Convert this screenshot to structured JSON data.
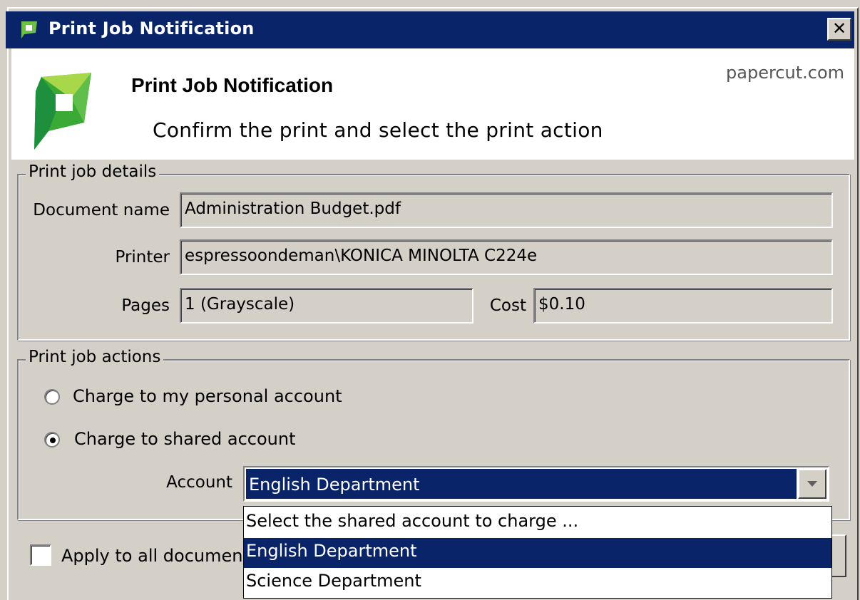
{
  "window": {
    "title": "Print Job Notification",
    "close_label": "✕"
  },
  "header": {
    "title": "Print Job Notification",
    "subtitle": "Confirm the print and select the print action",
    "brand": "papercut.com"
  },
  "details": {
    "legend": "Print job details",
    "document_label": "Document name",
    "document_value": "Administration Budget.pdf",
    "printer_label": "Printer",
    "printer_value": "espressoondeman\\KONICA MINOLTA C224e",
    "pages_label": "Pages",
    "pages_value": "1   (Grayscale)",
    "cost_label": "Cost",
    "cost_value": "$0.10"
  },
  "actions": {
    "legend": "Print job actions",
    "personal_label": "Charge to my personal account",
    "personal_selected": false,
    "shared_label": "Charge to shared account",
    "shared_selected": true,
    "account_label": "Account",
    "account_value": "English Department",
    "options": [
      "Select the shared account to charge ...",
      "English Department",
      "Science Department"
    ],
    "selected_option": "English Department"
  },
  "footer": {
    "apply_label": "Apply to all documen",
    "apply_checked": false
  },
  "colors": {
    "titlebar": "#0a246a",
    "selection": "#0a246a",
    "logo_green": "#6cc04a"
  }
}
